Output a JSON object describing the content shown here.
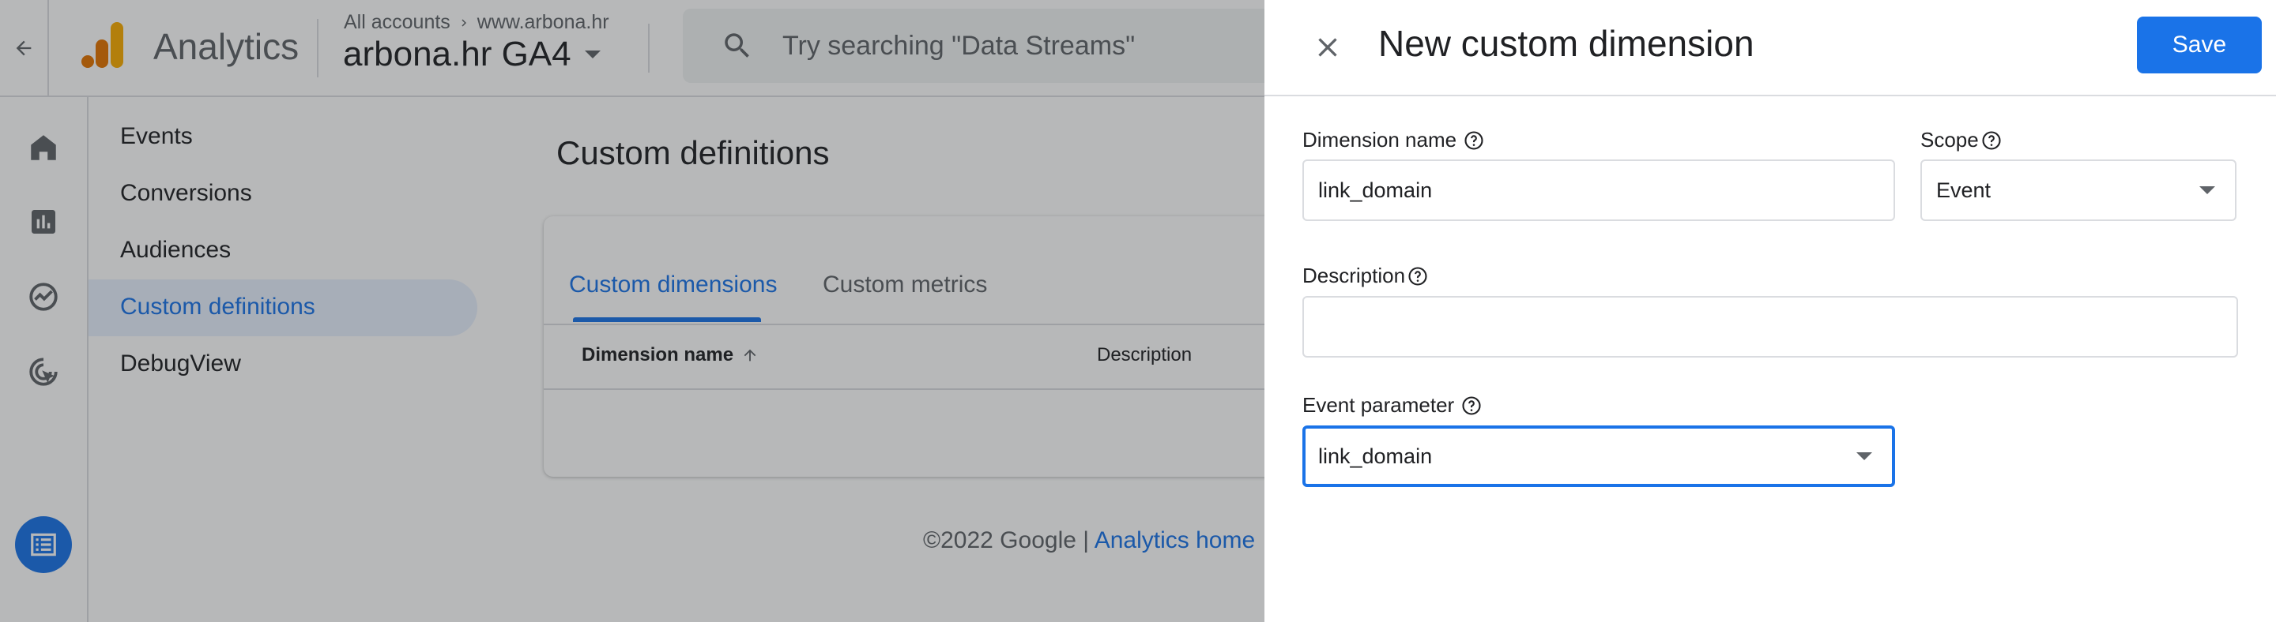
{
  "header": {
    "app_name": "Analytics",
    "breadcrumb_account": "All accounts",
    "breadcrumb_property": "www.arbona.hr",
    "property_name": "arbona.hr GA4",
    "search_placeholder": "Try searching \"Data Streams\""
  },
  "rail": {
    "icons": [
      "home-icon",
      "reports-icon",
      "explore-icon",
      "advertising-icon",
      "configure-icon"
    ],
    "active": "configure-icon"
  },
  "nav": {
    "items": [
      {
        "label": "Events"
      },
      {
        "label": "Conversions"
      },
      {
        "label": "Audiences"
      },
      {
        "label": "Custom definitions"
      },
      {
        "label": "DebugView"
      }
    ],
    "active_index": 3
  },
  "main": {
    "title": "Custom definitions",
    "tabs": [
      {
        "label": "Custom dimensions",
        "active": true
      },
      {
        "label": "Custom metrics",
        "active": false
      }
    ],
    "columns": [
      {
        "label": "Dimension name",
        "sort": "ascending"
      },
      {
        "label": "Description"
      }
    ],
    "footer_copyright": "©2022 Google |",
    "footer_link": "Analytics home"
  },
  "panel": {
    "title": "New custom dimension",
    "save_label": "Save",
    "dimension_name_label": "Dimension name",
    "dimension_name_value": "link_domain",
    "scope_label": "Scope",
    "scope_value": "Event",
    "description_label": "Description",
    "description_value": "",
    "event_parameter_label": "Event parameter",
    "event_parameter_value": "link_domain"
  },
  "colors": {
    "accent": "#1a73e8",
    "active_nav_bg": "#e8f0fe",
    "logo_orange": "#f9ab00",
    "logo_dark_orange": "#e37400"
  }
}
